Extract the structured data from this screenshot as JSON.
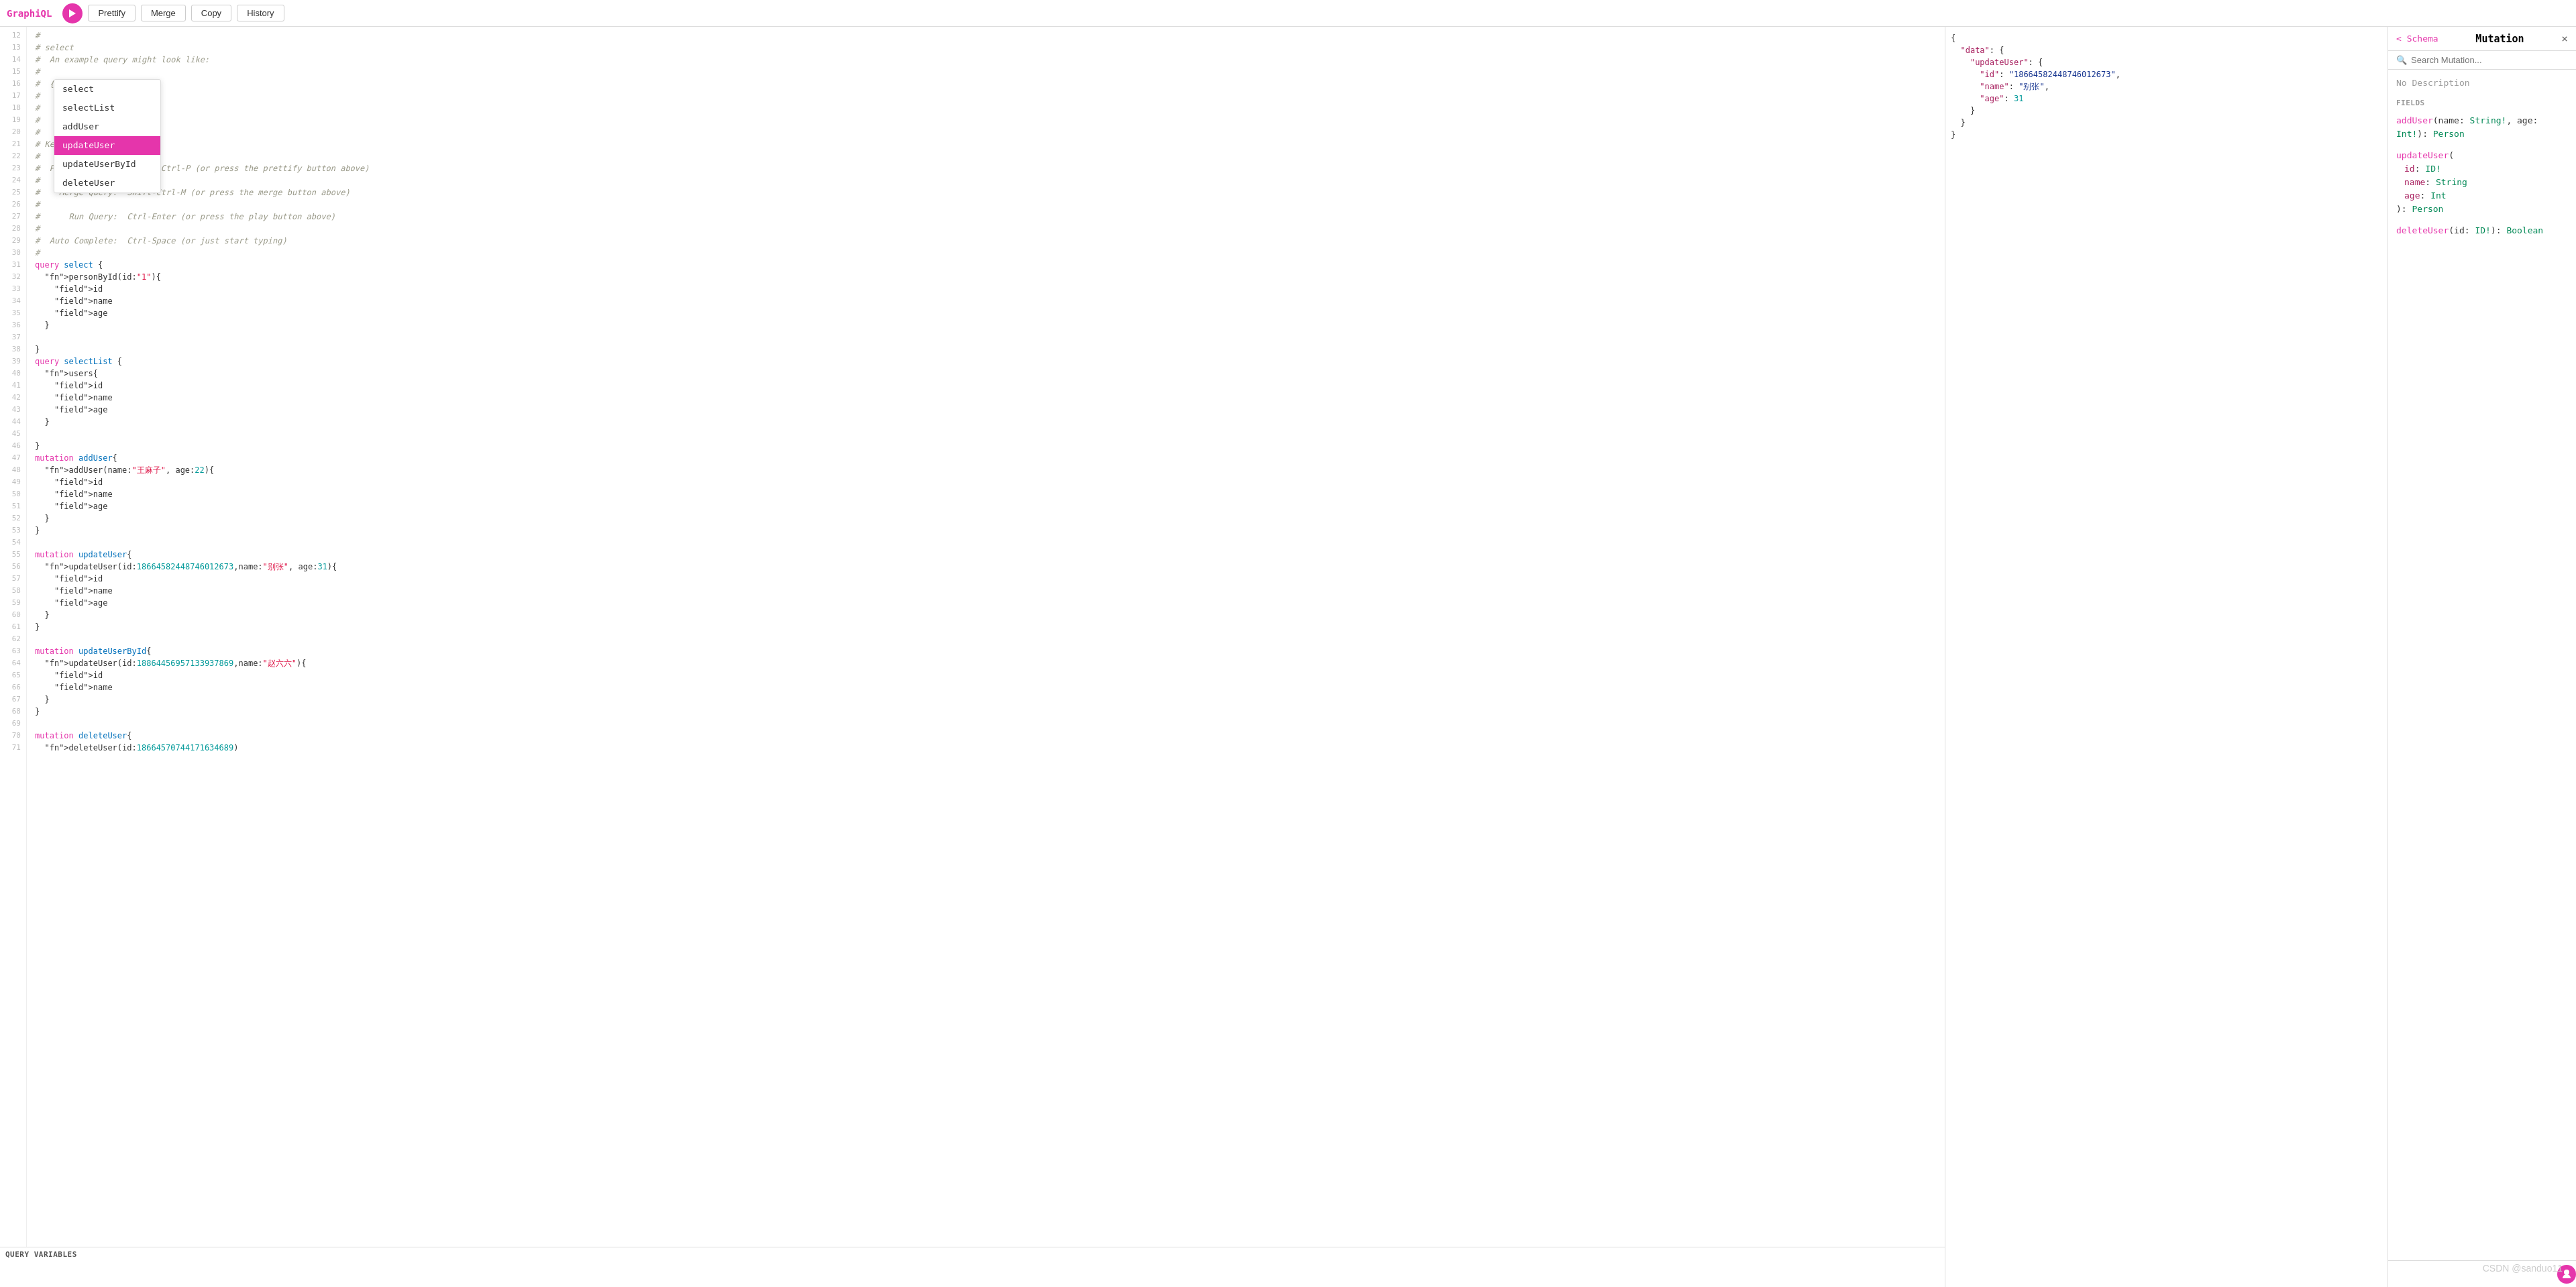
{
  "header": {
    "app_title": "GraphiQL",
    "run_label": "▶",
    "prettify_label": "Prettify",
    "merge_label": "Merge",
    "copy_label": "Copy",
    "history_label": "History"
  },
  "autocomplete": {
    "items": [
      {
        "label": "select",
        "selected": false
      },
      {
        "label": "selectList",
        "selected": false
      },
      {
        "label": "addUser",
        "selected": false
      },
      {
        "label": "updateUser",
        "selected": true
      },
      {
        "label": "updateUserById",
        "selected": false
      },
      {
        "label": "deleteUser",
        "selected": false
      }
    ]
  },
  "query_vars": {
    "header": "QUERY VARIABLES"
  },
  "schema": {
    "back_label": "< Schema",
    "title": "Mutation",
    "close_label": "×",
    "search_placeholder": "Search Mutation...",
    "no_description": "No Description",
    "fields_label": "FIELDS",
    "fields": [
      {
        "name": "addUser",
        "args": "(name: String!, age: Int!)",
        "return_type": "Person"
      },
      {
        "name": "updateUser",
        "args_detail": [
          {
            "key": "id",
            "type": "ID!"
          },
          {
            "key": "name",
            "type": "String"
          },
          {
            "key": "age",
            "type": "Int"
          }
        ],
        "return_type": "Person"
      },
      {
        "name": "deleteUser",
        "args": "(id: ID!)",
        "return_type": "Boolean"
      }
    ]
  },
  "results": {
    "json": "{\n  \"data\": {\n    \"updateUser\": {\n      \"id\": \"18664582448746012673\",\n      \"name\": \"别张\",\n      \"age\": 31\n    }\n  }\n}"
  },
  "watermark": "CSDN @sanduo11",
  "code_lines": [
    {
      "num": 12,
      "content": "# "
    },
    {
      "num": 13,
      "content": "# select"
    },
    {
      "num": 14,
      "content": "#  An example query might look like:"
    },
    {
      "num": 15,
      "content": "# "
    },
    {
      "num": 16,
      "content": "#  {"
    },
    {
      "num": 17,
      "content": "#    {"
    },
    {
      "num": 18,
      "content": "# "
    },
    {
      "num": 19,
      "content": "# "
    },
    {
      "num": 20,
      "content": "# "
    },
    {
      "num": 21,
      "content": "# Keyboard"
    },
    {
      "num": 22,
      "content": "# "
    },
    {
      "num": 23,
      "content": "#  Prettify Query:  Shift-Ctrl-P (or press the prettify button above)"
    },
    {
      "num": 24,
      "content": "# "
    },
    {
      "num": 25,
      "content": "#    Merge Query:  Shift-Ctrl-M (or press the merge button above)"
    },
    {
      "num": 26,
      "content": "# "
    },
    {
      "num": 27,
      "content": "#      Run Query:  Ctrl-Enter (or press the play button above)"
    },
    {
      "num": 28,
      "content": "# "
    },
    {
      "num": 29,
      "content": "#  Auto Complete:  Ctrl-Space (or just start typing)"
    },
    {
      "num": 30,
      "content": "# "
    },
    {
      "num": 31,
      "content": "query select {"
    },
    {
      "num": 32,
      "content": "  personById(id:\"1\"){"
    },
    {
      "num": 33,
      "content": "    id"
    },
    {
      "num": 34,
      "content": "    name"
    },
    {
      "num": 35,
      "content": "    age"
    },
    {
      "num": 36,
      "content": "  }"
    },
    {
      "num": 37,
      "content": ""
    },
    {
      "num": 38,
      "content": "}"
    },
    {
      "num": 39,
      "content": "query selectList {"
    },
    {
      "num": 40,
      "content": "  users{"
    },
    {
      "num": 41,
      "content": "    id"
    },
    {
      "num": 42,
      "content": "    name"
    },
    {
      "num": 43,
      "content": "    age"
    },
    {
      "num": 44,
      "content": "  }"
    },
    {
      "num": 45,
      "content": ""
    },
    {
      "num": 46,
      "content": "}"
    },
    {
      "num": 47,
      "content": "mutation addUser{"
    },
    {
      "num": 48,
      "content": "  addUser(name:\"王麻子\", age:22){"
    },
    {
      "num": 49,
      "content": "    id"
    },
    {
      "num": 50,
      "content": "    name"
    },
    {
      "num": 51,
      "content": "    age"
    },
    {
      "num": 52,
      "content": "  }"
    },
    {
      "num": 53,
      "content": "}"
    },
    {
      "num": 54,
      "content": ""
    },
    {
      "num": 55,
      "content": "mutation updateUser{"
    },
    {
      "num": 56,
      "content": "  updateUser(id:18664582448746012673,name:\"别张\", age:31){"
    },
    {
      "num": 57,
      "content": "    id"
    },
    {
      "num": 58,
      "content": "    name"
    },
    {
      "num": 59,
      "content": "    age"
    },
    {
      "num": 60,
      "content": "  }"
    },
    {
      "num": 61,
      "content": "}"
    },
    {
      "num": 62,
      "content": ""
    },
    {
      "num": 63,
      "content": "mutation updateUserById{"
    },
    {
      "num": 64,
      "content": "  updateUser(id:18864456957133937869,name:\"赵六六\"){"
    },
    {
      "num": 65,
      "content": "    id"
    },
    {
      "num": 66,
      "content": "    name"
    },
    {
      "num": 67,
      "content": "  }"
    },
    {
      "num": 68,
      "content": "}"
    },
    {
      "num": 69,
      "content": ""
    },
    {
      "num": 70,
      "content": "mutation deleteUser{"
    },
    {
      "num": 71,
      "content": "  deleteUser(id:18664570744171634689)"
    }
  ]
}
